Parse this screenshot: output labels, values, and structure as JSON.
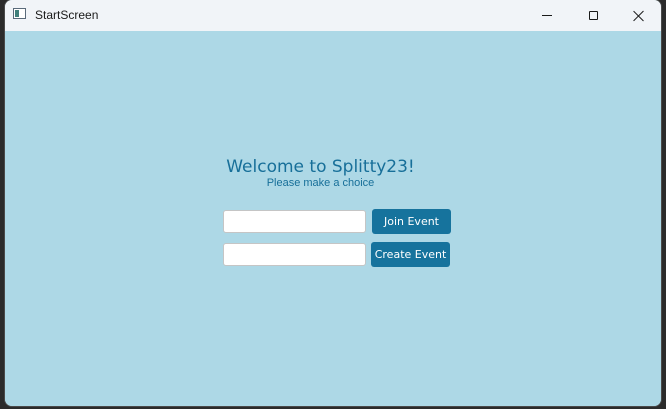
{
  "window": {
    "title": "StartScreen",
    "icon": "app-window-icon",
    "controls": {
      "minimize": "minimize-icon",
      "maximize": "maximize-icon",
      "close": "close-icon"
    }
  },
  "start": {
    "welcome": "Welcome to Splitty23!",
    "subtitle": "Please make a choice",
    "join_input_value": "",
    "create_input_value": "",
    "join_button_label": "Join Event",
    "create_button_label": "Create Event"
  },
  "colors": {
    "background": "#add8e6",
    "accent": "#16739d",
    "heading_text": "#176f99",
    "titlebar": "#f1f4f8"
  }
}
